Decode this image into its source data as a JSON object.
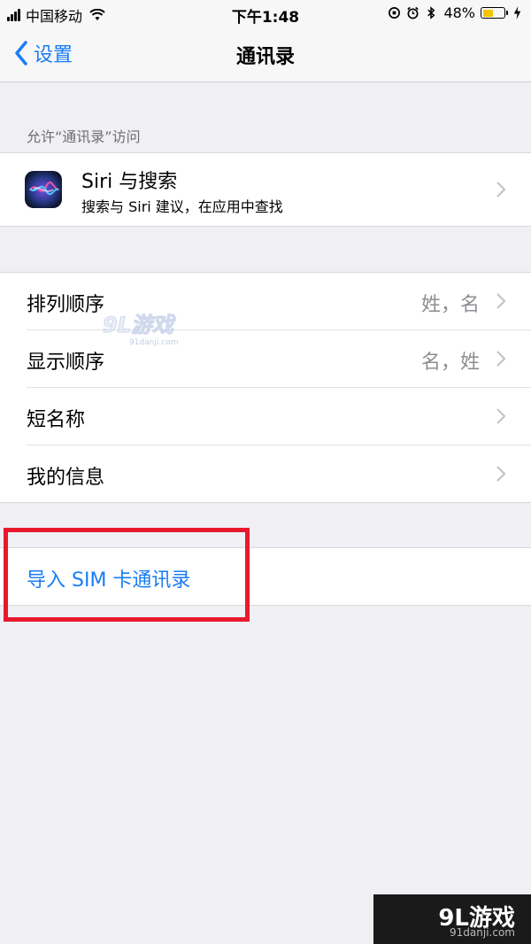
{
  "status": {
    "carrier": "中国移动",
    "time": "下午1:48",
    "battery": "48%",
    "battery_level": 0.48
  },
  "nav": {
    "back_label": "设置",
    "title": "通讯录"
  },
  "section_header": "允许“通讯录”访问",
  "siri": {
    "title": "Siri 与搜索",
    "subtitle": "搜索与 Siri 建议，在应用中查找"
  },
  "settings": [
    {
      "label": "排列顺序",
      "value": "姓，名"
    },
    {
      "label": "显示顺序",
      "value": "名，姓"
    },
    {
      "label": "短名称",
      "value": ""
    },
    {
      "label": "我的信息",
      "value": ""
    }
  ],
  "import_sim": "导入 SIM 卡通讯录",
  "watermark": {
    "mid_logo": "9L游戏",
    "mid_url": "91danji.com",
    "corner_logo": "9L游戏",
    "corner_url": "91danji.com"
  },
  "colors": {
    "accent": "#1a7cf5",
    "highlight": "#e8192c",
    "background": "#efeff4"
  }
}
